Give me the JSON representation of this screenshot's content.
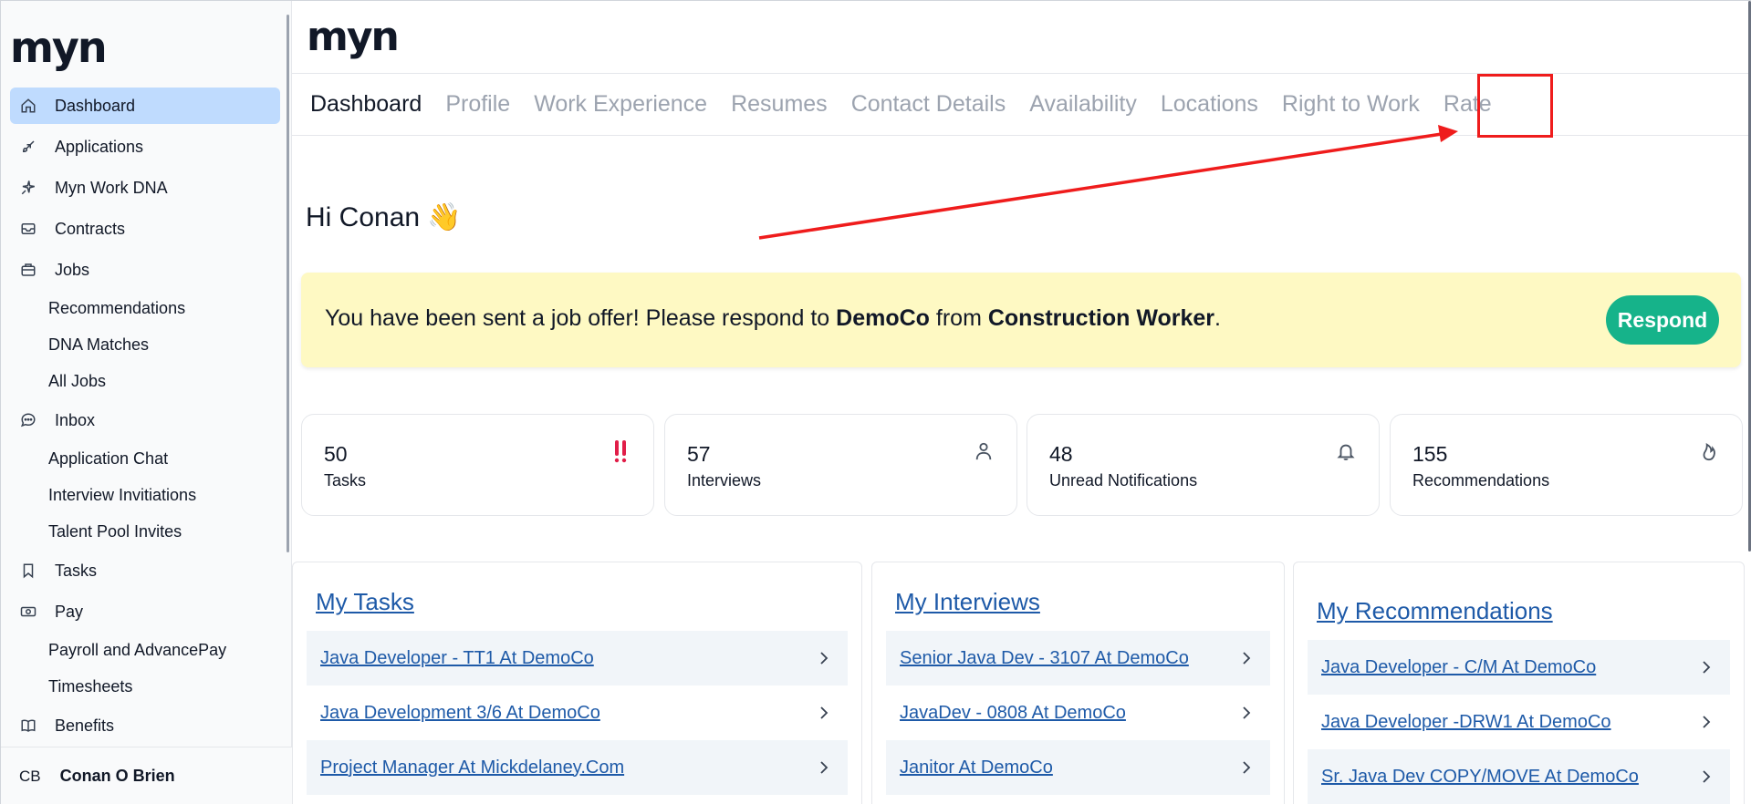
{
  "app": {
    "logo": "myn"
  },
  "sidebar": {
    "items": [
      {
        "label": "Dashboard",
        "icon": "home-icon",
        "active": true
      },
      {
        "label": "Applications",
        "icon": "rocket-icon"
      },
      {
        "label": "Myn Work DNA",
        "icon": "sparkle-icon"
      },
      {
        "label": "Contracts",
        "icon": "inbox-tray-icon"
      },
      {
        "label": "Jobs",
        "icon": "briefcase-icon"
      },
      {
        "label": "Recommendations",
        "sub": true
      },
      {
        "label": "DNA Matches",
        "sub": true
      },
      {
        "label": "All Jobs",
        "sub": true
      },
      {
        "label": "Inbox",
        "icon": "chat-icon"
      },
      {
        "label": "Application Chat",
        "sub": true
      },
      {
        "label": "Interview Invitiations",
        "sub": true
      },
      {
        "label": "Talent Pool Invites",
        "sub": true
      },
      {
        "label": "Tasks",
        "icon": "bookmark-icon"
      },
      {
        "label": "Pay",
        "icon": "money-icon"
      },
      {
        "label": "Payroll and AdvancePay",
        "sub": true
      },
      {
        "label": "Timesheets",
        "sub": true
      },
      {
        "label": "Benefits",
        "icon": "book-icon"
      }
    ],
    "user": {
      "initials": "CB",
      "name": "Conan O Brien"
    }
  },
  "tabs": [
    "Dashboard",
    "Profile",
    "Work Experience",
    "Resumes",
    "Contact Details",
    "Availability",
    "Locations",
    "Right to Work",
    "Rate"
  ],
  "greeting": {
    "text": "Hi Conan",
    "emoji": "👋"
  },
  "offer": {
    "prefix": "You have been sent a job offer! Please respond to ",
    "company": "DemoCo",
    "middle": " from ",
    "job": "Construction Worker",
    "suffix": ".",
    "button": "Respond"
  },
  "stats": [
    {
      "value": "50",
      "label": "Tasks",
      "icon": "double-exclamation-icon",
      "icon_color": "#e11d48"
    },
    {
      "value": "57",
      "label": "Interviews",
      "icon": "person-icon"
    },
    {
      "value": "48",
      "label": "Unread Notifications",
      "icon": "bell-icon"
    },
    {
      "value": "155",
      "label": "Recommendations",
      "icon": "flame-icon"
    }
  ],
  "panels": {
    "tasks": {
      "title": "My Tasks",
      "items": [
        "Java Developer - TT1 At DemoCo",
        "Java Development 3/6 At DemoCo",
        "Project Manager At Mickdelaney.Com"
      ]
    },
    "interviews": {
      "title": "My Interviews",
      "items": [
        "Senior Java Dev - 3107 At DemoCo",
        "JavaDev - 0808 At DemoCo",
        "Janitor At DemoCo"
      ]
    },
    "recommendations": {
      "title": "My Recommendations",
      "items": [
        "Java Developer - C/M At DemoCo",
        "Java Developer -DRW1 At DemoCo",
        "Sr. Java Dev COPY/MOVE At DemoCo"
      ]
    }
  },
  "colors": {
    "accent": "#bfdbfe",
    "respond": "#16b38a",
    "banner": "#fef9c3",
    "annotation": "#ef1c1c",
    "link": "#1e5aa8"
  }
}
